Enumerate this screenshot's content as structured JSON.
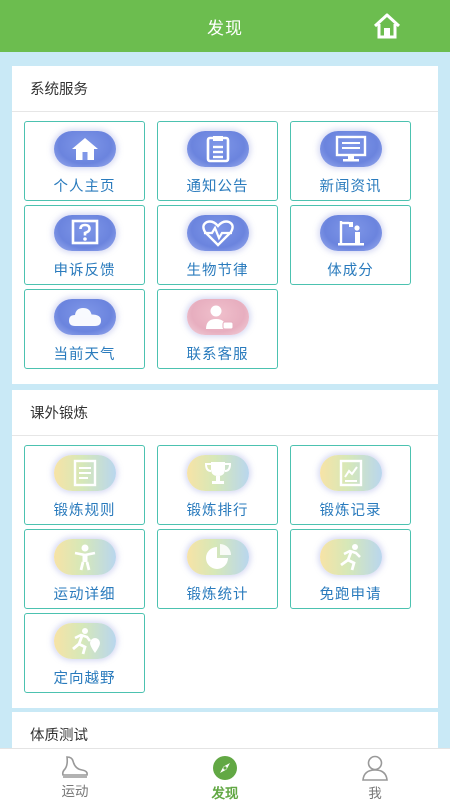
{
  "header": {
    "title": "发现",
    "home_icon": "home-icon"
  },
  "colors": {
    "header": "#6cbd4f",
    "tile_border": "#4cc2b0",
    "label": "#2a7bbd",
    "nav_active": "#62a844"
  },
  "sections": [
    {
      "title": "系统服务",
      "items": [
        {
          "label": "个人主页",
          "icon": "home-icon"
        },
        {
          "label": "通知公告",
          "icon": "clipboard-icon"
        },
        {
          "label": "新闻资讯",
          "icon": "monitor-icon"
        },
        {
          "label": "申诉反馈",
          "icon": "question-icon"
        },
        {
          "label": "生物节律",
          "icon": "heartbeat-icon"
        },
        {
          "label": "体成分",
          "icon": "body-scale-icon"
        },
        {
          "label": "当前天气",
          "icon": "cloud-icon"
        },
        {
          "label": "联系客服",
          "icon": "support-person-icon"
        }
      ]
    },
    {
      "title": "课外锻炼",
      "items": [
        {
          "label": "锻炼规则",
          "icon": "document-icon"
        },
        {
          "label": "锻炼排行",
          "icon": "trophy-icon"
        },
        {
          "label": "锻炼记录",
          "icon": "chart-record-icon"
        },
        {
          "label": "运动详细",
          "icon": "person-icon"
        },
        {
          "label": "锻炼统计",
          "icon": "pie-chart-icon"
        },
        {
          "label": "免跑申请",
          "icon": "runner-icon"
        },
        {
          "label": "定向越野",
          "icon": "runner-location-icon"
        }
      ]
    },
    {
      "title": "体质测试",
      "items": []
    }
  ],
  "nav": [
    {
      "label": "运动",
      "icon": "shoe-icon",
      "active": false
    },
    {
      "label": "发现",
      "icon": "compass-icon",
      "active": true
    },
    {
      "label": "我",
      "icon": "user-icon",
      "active": false
    }
  ]
}
